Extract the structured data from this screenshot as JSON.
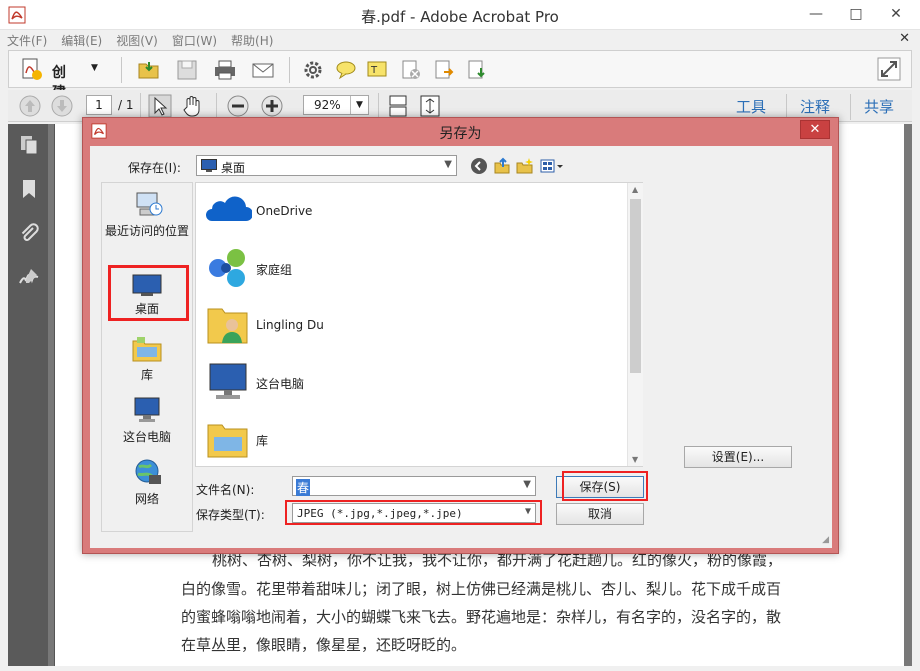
{
  "window": {
    "title": "春.pdf - Adobe Acrobat Pro",
    "minimize": "—",
    "restore": "□",
    "close": "✕",
    "menu_close": "✕"
  },
  "menu": {
    "items": [
      "文件(F)",
      "编辑(E)",
      "视图(V)",
      "窗口(W)",
      "帮助(H)"
    ]
  },
  "toolbar": {
    "create_label": "创建",
    "page_current": "1",
    "page_total": "/ 1",
    "zoom_value": "92%",
    "tabs": [
      "工具",
      "注释",
      "共享"
    ]
  },
  "document": {
    "lines": [
      "桃树、杏树、梨树，你不让我，我不让你，都开满了花赶趟儿。红的像火，粉的像霞，",
      "白的像雪。花里带着甜味儿；闭了眼，树上仿佛已经满是桃儿、杏儿、梨儿。花下成千成百",
      "的蜜蜂嗡嗡地闹着，大小的蝴蝶飞来飞去。野花遍地是：杂样儿，有名字的，没名字的，散",
      "在草丛里，像眼睛，像星星，还眨呀眨的。"
    ]
  },
  "dialog": {
    "title": "另存为",
    "close": "✕",
    "save_in_label": "保存在(I):",
    "save_in_value": "桌面",
    "places": [
      {
        "label": "最近访问的位置",
        "icon": "recent-places-icon"
      },
      {
        "label": "桌面",
        "icon": "desktop-icon"
      },
      {
        "label": "库",
        "icon": "library-icon"
      },
      {
        "label": "这台电脑",
        "icon": "computer-icon"
      },
      {
        "label": "网络",
        "icon": "network-icon"
      }
    ],
    "files": [
      {
        "name": "OneDrive",
        "icon": "onedrive-icon"
      },
      {
        "name": "家庭组",
        "icon": "homegroup-icon"
      },
      {
        "name": "Lingling Du",
        "icon": "user-folder-icon"
      },
      {
        "name": "这台电脑",
        "icon": "computer-icon"
      },
      {
        "name": "库",
        "icon": "library-icon"
      }
    ],
    "filename_label": "文件名(N):",
    "filename_value": "春",
    "filetype_label": "保存类型(T):",
    "filetype_value": "JPEG (*.jpg,*.jpeg,*.jpe)",
    "save_button": "保存(S)",
    "cancel_button": "取消",
    "settings_button": "设置(E)...",
    "highlight_color": "#e22222",
    "frame_color": "#d97b7b"
  }
}
